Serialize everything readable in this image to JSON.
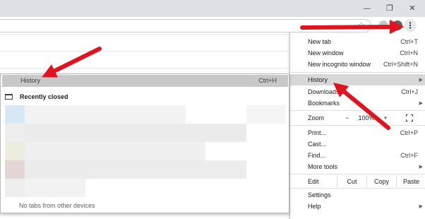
{
  "window_controls": {
    "minimize_icon": "minimize-icon",
    "restore_icon": "restore-icon",
    "close_icon": "close-icon"
  },
  "toolbar": {
    "star_icon": "star-icon",
    "menu_icon": "kebab-menu-icon"
  },
  "main_menu": {
    "items": [
      {
        "label": "New tab",
        "shortcut": "Ctrl+T"
      },
      {
        "label": "New window",
        "shortcut": "Ctrl+N"
      },
      {
        "label": "New incognito window",
        "shortcut": "Ctrl+Shift+N"
      },
      {
        "label": "History",
        "shortcut": ""
      },
      {
        "label": "Downloads",
        "shortcut": "Ctrl+J"
      },
      {
        "label": "Bookmarks",
        "shortcut": ""
      },
      {
        "label": "Zoom",
        "shortcut": ""
      },
      {
        "label": "Print...",
        "shortcut": "Ctrl+P"
      },
      {
        "label": "Cast...",
        "shortcut": ""
      },
      {
        "label": "Find...",
        "shortcut": "Ctrl+F"
      },
      {
        "label": "More tools",
        "shortcut": ""
      },
      {
        "label": "Edit",
        "shortcut": ""
      },
      {
        "label": "Settings",
        "shortcut": ""
      },
      {
        "label": "Help",
        "shortcut": ""
      }
    ],
    "zoom": {
      "minus": "−",
      "value": "100%",
      "plus": "+",
      "fullscreen_icon": "fullscreen-icon"
    },
    "edit": {
      "cut": "Cut",
      "copy": "Copy",
      "paste": "Paste"
    }
  },
  "history_submenu": {
    "history_label": "History",
    "history_shortcut": "Ctrl+H",
    "recently_closed_label": "Recently closed",
    "no_tabs_text": "No tabs from other devices"
  },
  "colors": {
    "annotation_arrow": "#e0141e",
    "menu_hover": "#d8d8d8"
  }
}
